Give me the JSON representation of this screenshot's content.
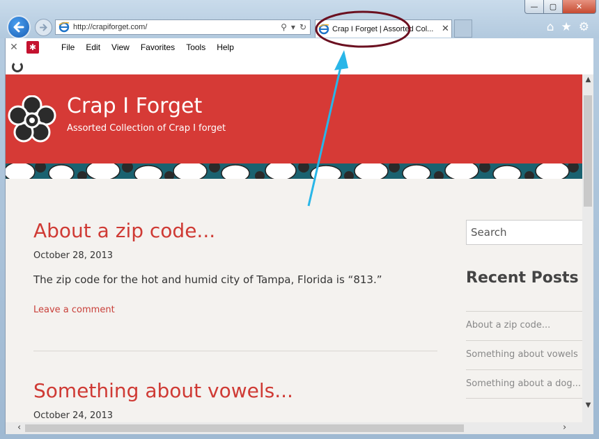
{
  "browser": {
    "url": "http://crapiforget.com/",
    "tab_title": "Crap I Forget | Assorted Col...",
    "tab_close": "✕",
    "window_controls": {
      "minimize": "—",
      "maximize": "▢",
      "close": "✕"
    },
    "right_icons": [
      "home-icon",
      "star-icon",
      "gear-icon"
    ]
  },
  "menu": {
    "close_glyph": "✕",
    "items": [
      "File",
      "Edit",
      "View",
      "Favorites",
      "Tools",
      "Help"
    ]
  },
  "site": {
    "title": "Crap I Forget",
    "tagline": "Assorted Collection of Crap I forget",
    "header_color": "#d63a36"
  },
  "posts": [
    {
      "title": "About a zip code...",
      "date": "October 28, 2013",
      "body": "The zip code for the hot and humid city of Tampa, Florida is “813.”",
      "link": "Leave a comment"
    },
    {
      "title": "Something about vowels...",
      "date": "October 24, 2013"
    }
  ],
  "sidebar": {
    "search_placeholder": "Search",
    "widget_title": "Recent Posts",
    "recent": [
      "About a zip code...",
      "Something about vowels",
      "Something about a dog..."
    ]
  },
  "annotation": {
    "color_circle": "#6b1020",
    "color_arrow": "#29b6e8"
  }
}
